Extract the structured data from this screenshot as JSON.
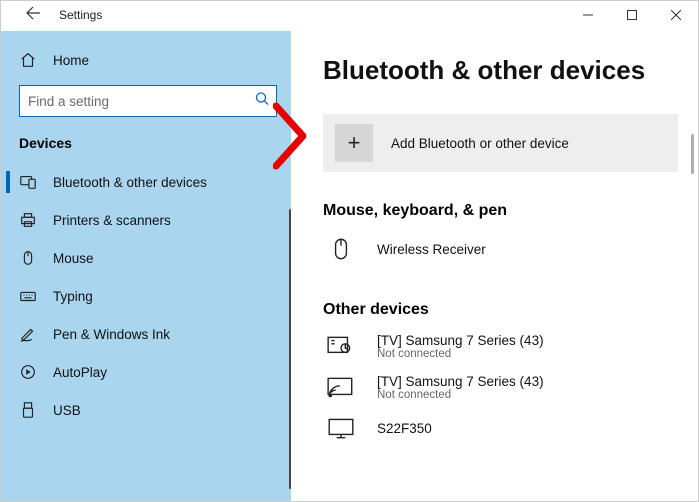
{
  "titlebar": {
    "title": "Settings"
  },
  "sidebar": {
    "home_label": "Home",
    "search_placeholder": "Find a setting",
    "section_title": "Devices",
    "items": [
      {
        "label": "Bluetooth & other devices"
      },
      {
        "label": "Printers & scanners"
      },
      {
        "label": "Mouse"
      },
      {
        "label": "Typing"
      },
      {
        "label": "Pen & Windows Ink"
      },
      {
        "label": "AutoPlay"
      },
      {
        "label": "USB"
      }
    ]
  },
  "main": {
    "page_title": "Bluetooth & other devices",
    "add_device_label": "Add Bluetooth or other device",
    "groups": [
      {
        "title": "Mouse, keyboard, & pen",
        "devices": [
          {
            "name": "Wireless Receiver",
            "status": ""
          }
        ]
      },
      {
        "title": "Other devices",
        "devices": [
          {
            "name": "[TV] Samsung 7 Series (43)",
            "status": "Not connected"
          },
          {
            "name": "[TV] Samsung 7 Series (43)",
            "status": "Not connected"
          },
          {
            "name": "S22F350",
            "status": ""
          }
        ]
      }
    ]
  }
}
